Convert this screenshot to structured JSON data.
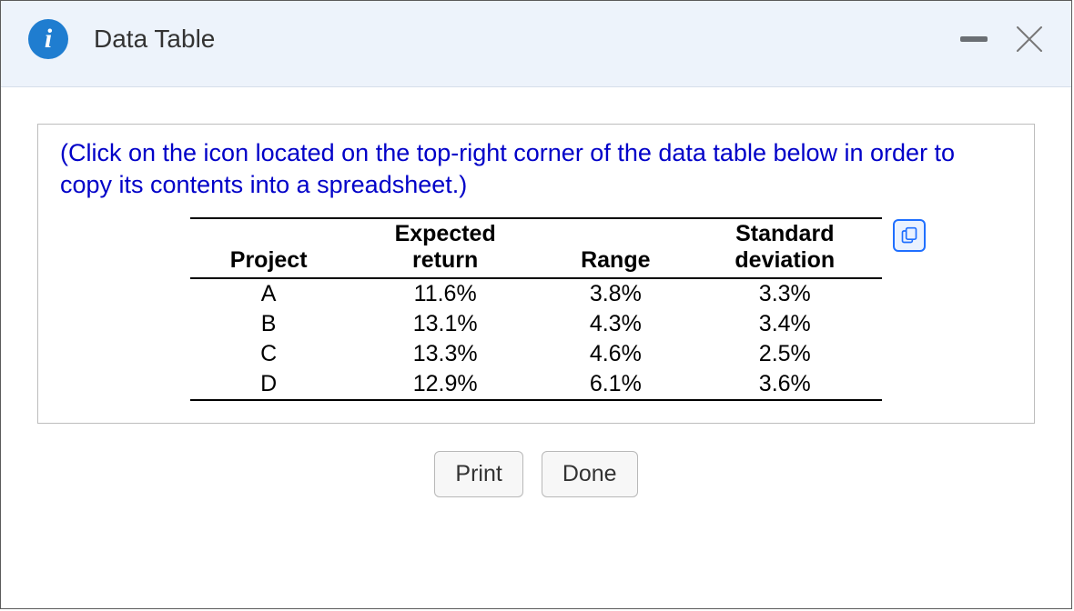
{
  "header": {
    "title": "Data Table"
  },
  "instruction": "(Click on the icon located on the top-right corner of the data table below in order to copy its contents into a spreadsheet.)",
  "table": {
    "columns": [
      "Project",
      "Expected return",
      "Range",
      "Standard deviation"
    ],
    "rows": [
      {
        "project": "A",
        "expected_return": "11.6%",
        "range": "3.8%",
        "std_dev": "3.3%"
      },
      {
        "project": "B",
        "expected_return": "13.1%",
        "range": "4.3%",
        "std_dev": "3.4%"
      },
      {
        "project": "C",
        "expected_return": "13.3%",
        "range": "4.6%",
        "std_dev": "2.5%"
      },
      {
        "project": "D",
        "expected_return": "12.9%",
        "range": "6.1%",
        "std_dev": "3.6%"
      }
    ]
  },
  "buttons": {
    "print": "Print",
    "done": "Done"
  },
  "chart_data": {
    "type": "table",
    "columns": [
      "Project",
      "Expected return",
      "Range",
      "Standard deviation"
    ],
    "rows": [
      [
        "A",
        "11.6%",
        "3.8%",
        "3.3%"
      ],
      [
        "B",
        "13.1%",
        "4.3%",
        "3.4%"
      ],
      [
        "C",
        "13.3%",
        "4.6%",
        "2.5%"
      ],
      [
        "D",
        "12.9%",
        "6.1%",
        "3.6%"
      ]
    ]
  }
}
